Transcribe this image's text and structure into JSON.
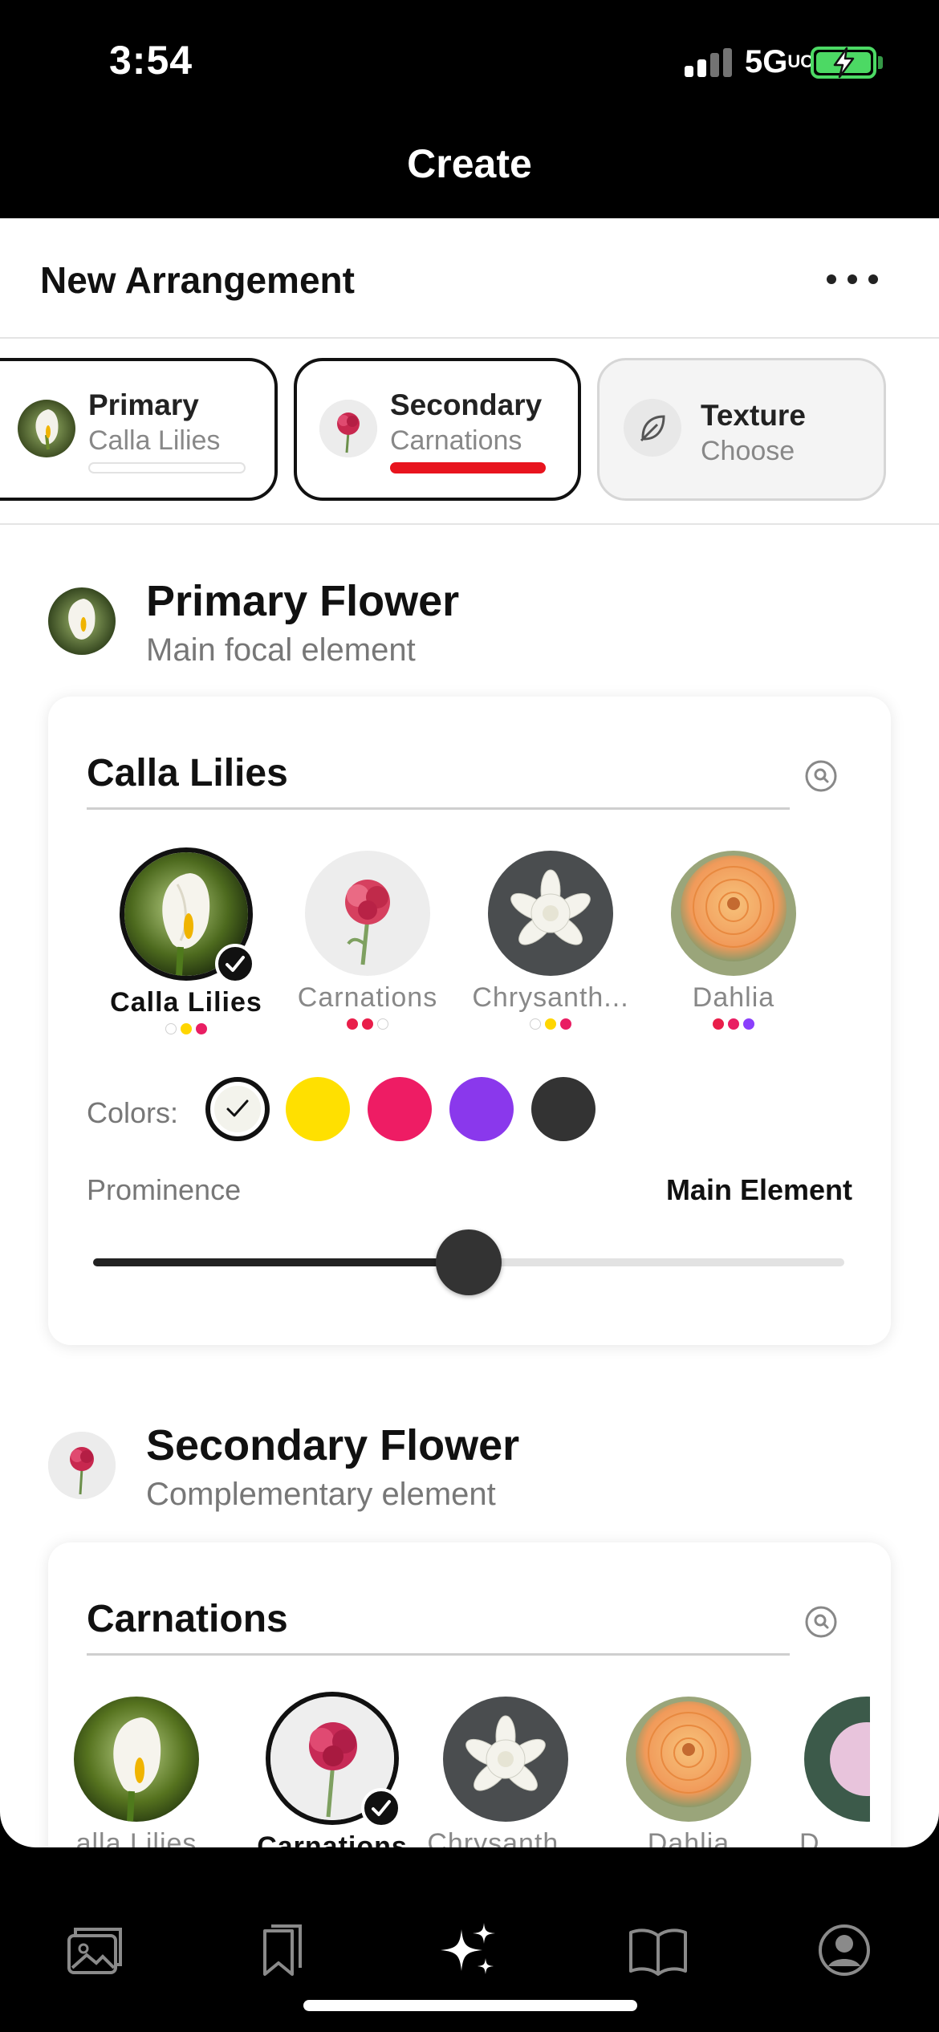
{
  "status_bar": {
    "time": "3:54",
    "network": "5G",
    "network_suffix": "UC",
    "battery_color": "#4cd964"
  },
  "nav": {
    "title": "Create"
  },
  "arrangement": {
    "title": "New Arrangement",
    "more_icon": "more-dots-icon"
  },
  "tabs": [
    {
      "title": "Primary",
      "subtitle": "Calla Lilies",
      "state": "active"
    },
    {
      "title": "Secondary",
      "subtitle": "Carnations",
      "state": "selected",
      "underline_color": "#e8141e"
    },
    {
      "title": "Texture",
      "subtitle": "Choose",
      "state": "inactive",
      "icon": "leaf-icon"
    }
  ],
  "primary_section": {
    "title": "Primary Flower",
    "subtitle": "Main focal element",
    "panel": {
      "title": "Calla Lilies",
      "search_icon": "search-icon",
      "flowers": [
        {
          "name": "Calla Lilies",
          "selected": true,
          "dots": [
            "#ffffff",
            "#ffd600",
            "#e91e63"
          ]
        },
        {
          "name": "Carnations",
          "selected": false,
          "dots": [
            "#e91e4a",
            "#e91e4a",
            "#ffffff"
          ]
        },
        {
          "name": "Chrysanth...",
          "selected": false,
          "dots": [
            "#ffffff",
            "#ffd600",
            "#e91e63"
          ]
        },
        {
          "name": "Dahlia",
          "selected": false,
          "dots": [
            "#e91e4a",
            "#e91e63",
            "#8a3ffc"
          ]
        }
      ],
      "colors_label": "Colors:",
      "colors": [
        {
          "hex": "#f3f3ec",
          "selected": true
        },
        {
          "hex": "#ffe000",
          "selected": false
        },
        {
          "hex": "#ee1c64",
          "selected": false
        },
        {
          "hex": "#8a38ec",
          "selected": false
        },
        {
          "hex": "#333333",
          "selected": false
        }
      ],
      "prominence_label": "Prominence",
      "prominence_value": "Main Element",
      "prominence_level": 0.5
    }
  },
  "secondary_section": {
    "title": "Secondary Flower",
    "subtitle": "Complementary element",
    "panel": {
      "title": "Carnations",
      "search_icon": "search-icon",
      "flowers": [
        {
          "name": "alla Lilies",
          "selected": false,
          "dots": [
            "#ffffff",
            "#ffd600",
            "#e91e63"
          ]
        },
        {
          "name": "Carnations",
          "selected": true,
          "dots": [
            "#e91e4a",
            "#e91e4a",
            "#ffffff"
          ]
        },
        {
          "name": "Chrysanth...",
          "selected": false,
          "dots": [
            "#ffffff",
            "#ffd600",
            "#e91e63"
          ]
        },
        {
          "name": "Dahlia",
          "selected": false,
          "dots": [
            "#e91e4a",
            "#e91e63",
            "#8a3ffc"
          ]
        },
        {
          "name": "D",
          "selected": false,
          "dots": []
        }
      ]
    }
  },
  "tab_bar": {
    "items": [
      {
        "icon": "photos-icon",
        "active": false
      },
      {
        "icon": "bookmarks-icon",
        "active": false
      },
      {
        "icon": "sparkles-icon",
        "active": true
      },
      {
        "icon": "book-icon",
        "active": false
      },
      {
        "icon": "profile-icon",
        "active": false
      }
    ]
  }
}
